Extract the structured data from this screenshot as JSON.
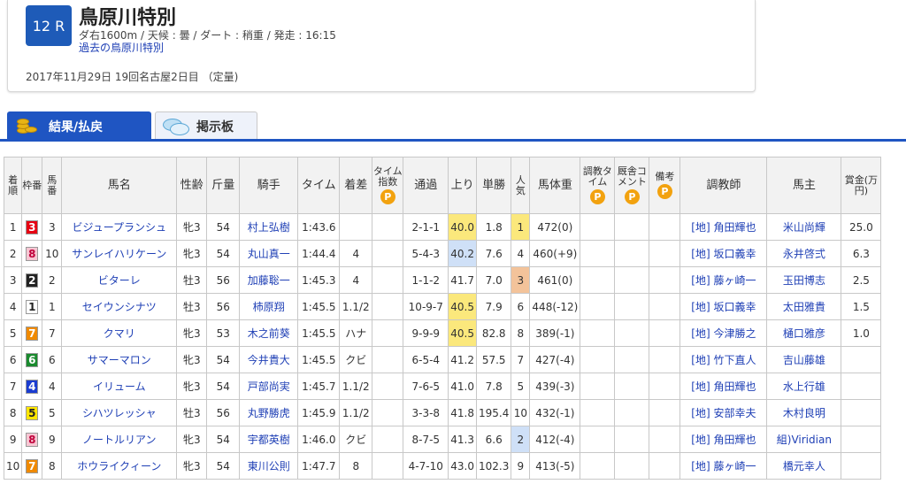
{
  "race": {
    "number": "12 R",
    "title": "鳥原川特別",
    "conditions": "ダ右1600m / 天候 : 曇 / ダート : 稍重 / 発走 : 16:15",
    "past_link": "過去の鳥原川特別",
    "date_info": "2017年11月29日 19回名古屋2日目 （定量)"
  },
  "tabs": [
    {
      "label": "結果/払戻",
      "icon": "coins-icon",
      "active": true
    },
    {
      "label": "掲示板",
      "icon": "speech-bubble-icon",
      "active": false
    }
  ],
  "columns": {
    "rank": "着順",
    "waku": "枠番",
    "umaban": "馬番",
    "name": "馬名",
    "sexage": "性齢",
    "weight": "斤量",
    "jockey": "騎手",
    "time": "タイム",
    "margin": "着差",
    "time_index": "タイム指数",
    "passing": "通過",
    "last3f": "上り",
    "odds": "単勝",
    "pop": "人気",
    "horse_weight": "馬体重",
    "training_time": "調教タイム",
    "stable_comment": "厩舎コメント",
    "remarks": "備考",
    "trainer": "調教師",
    "owner": "馬主",
    "prize": "賞金(万円)",
    "premium_icon": "P"
  },
  "colors": {
    "accent": "#1f55c2",
    "link": "#1e3fb5",
    "premium": "#f2a20f",
    "waku": {
      "1": "#ffffff",
      "2": "#222222",
      "3": "#e60012",
      "4": "#1a3cd0",
      "5": "#ffe600",
      "6": "#1a8a2e",
      "7": "#f08a00",
      "8": "#f7c6d3"
    }
  },
  "rows": [
    {
      "rank": "1",
      "waku": "3",
      "umaban": "3",
      "name": "ビジュープランシュ",
      "sexage": "牝3",
      "weight": "54",
      "jockey": "村上弘樹",
      "time": "1:43.6",
      "margin": "",
      "passing": "2-1-1",
      "last3f": "40.0",
      "last3f_hl": "y",
      "odds": "1.8",
      "pop": "1",
      "pop_hl": "y",
      "horse_weight": "472(0)",
      "trainer": "[地] 角田輝也",
      "owner": "米山尚輝",
      "prize": "25.0"
    },
    {
      "rank": "2",
      "waku": "8",
      "umaban": "10",
      "name": "サンレイハリケーン",
      "sexage": "牝3",
      "weight": "54",
      "jockey": "丸山真一",
      "time": "1:44.4",
      "margin": "4",
      "passing": "5-4-3",
      "last3f": "40.2",
      "last3f_hl": "b",
      "odds": "7.6",
      "pop": "4",
      "pop_hl": "",
      "horse_weight": "460(+9)",
      "trainer": "[地] 坂口義幸",
      "owner": "永井啓弍",
      "prize": "6.3"
    },
    {
      "rank": "3",
      "waku": "2",
      "umaban": "2",
      "name": "ビターレ",
      "sexage": "牡3",
      "weight": "56",
      "jockey": "加藤聡一",
      "time": "1:45.3",
      "margin": "4",
      "passing": "1-1-2",
      "last3f": "41.7",
      "last3f_hl": "",
      "odds": "7.0",
      "pop": "3",
      "pop_hl": "o",
      "horse_weight": "461(0)",
      "trainer": "[地] 藤ヶ崎一",
      "owner": "玉田博志",
      "prize": "2.5"
    },
    {
      "rank": "4",
      "waku": "1",
      "umaban": "1",
      "name": "セイウンシナツ",
      "sexage": "牡3",
      "weight": "56",
      "jockey": "柿原翔",
      "time": "1:45.5",
      "margin": "1.1/2",
      "passing": "10-9-7",
      "last3f": "40.5",
      "last3f_hl": "y",
      "odds": "7.9",
      "pop": "6",
      "pop_hl": "",
      "horse_weight": "448(-12)",
      "trainer": "[地] 坂口義幸",
      "owner": "太田雅貴",
      "prize": "1.5"
    },
    {
      "rank": "5",
      "waku": "7",
      "umaban": "7",
      "name": "クマリ",
      "sexage": "牝3",
      "weight": "53",
      "jockey": "木之前葵",
      "time": "1:45.5",
      "margin": "ハナ",
      "passing": "9-9-9",
      "last3f": "40.5",
      "last3f_hl": "y",
      "odds": "82.8",
      "pop": "8",
      "pop_hl": "",
      "horse_weight": "389(-1)",
      "trainer": "[地] 今津勝之",
      "owner": "樋口雅彦",
      "prize": "1.0"
    },
    {
      "rank": "6",
      "waku": "6",
      "umaban": "6",
      "name": "サマーマロン",
      "sexage": "牝3",
      "weight": "54",
      "jockey": "今井貴大",
      "time": "1:45.5",
      "margin": "クビ",
      "passing": "6-5-4",
      "last3f": "41.2",
      "last3f_hl": "",
      "odds": "57.5",
      "pop": "7",
      "pop_hl": "",
      "horse_weight": "427(-4)",
      "trainer": "[地] 竹下直人",
      "owner": "吉山藤雄",
      "prize": ""
    },
    {
      "rank": "7",
      "waku": "4",
      "umaban": "4",
      "name": "イリューム",
      "sexage": "牝3",
      "weight": "54",
      "jockey": "戸部尚実",
      "time": "1:45.7",
      "margin": "1.1/2",
      "passing": "7-6-5",
      "last3f": "41.0",
      "last3f_hl": "",
      "odds": "7.8",
      "pop": "5",
      "pop_hl": "",
      "horse_weight": "439(-3)",
      "trainer": "[地] 角田輝也",
      "owner": "水上行雄",
      "prize": ""
    },
    {
      "rank": "8",
      "waku": "5",
      "umaban": "5",
      "name": "シハツレッシャ",
      "sexage": "牡3",
      "weight": "56",
      "jockey": "丸野勝虎",
      "time": "1:45.9",
      "margin": "1.1/2",
      "passing": "3-3-8",
      "last3f": "41.8",
      "last3f_hl": "",
      "odds": "195.4",
      "pop": "10",
      "pop_hl": "",
      "horse_weight": "432(-1)",
      "trainer": "[地] 安部幸夫",
      "owner": "木村良明",
      "prize": ""
    },
    {
      "rank": "9",
      "waku": "8",
      "umaban": "9",
      "name": "ノートルリアン",
      "sexage": "牝3",
      "weight": "54",
      "jockey": "宇都英樹",
      "time": "1:46.0",
      "margin": "クビ",
      "passing": "8-7-5",
      "last3f": "41.3",
      "last3f_hl": "",
      "odds": "6.6",
      "pop": "2",
      "pop_hl": "b",
      "horse_weight": "412(-4)",
      "trainer": "[地] 角田輝也",
      "owner": "組)Viridian",
      "prize": ""
    },
    {
      "rank": "10",
      "waku": "7",
      "umaban": "8",
      "name": "ホウライクィーン",
      "sexage": "牝3",
      "weight": "54",
      "jockey": "東川公則",
      "time": "1:47.7",
      "margin": "8",
      "passing": "4-7-10",
      "last3f": "43.0",
      "last3f_hl": "",
      "odds": "102.3",
      "pop": "9",
      "pop_hl": "",
      "horse_weight": "413(-5)",
      "trainer": "[地] 藤ヶ崎一",
      "owner": "橋元幸人",
      "prize": ""
    }
  ]
}
